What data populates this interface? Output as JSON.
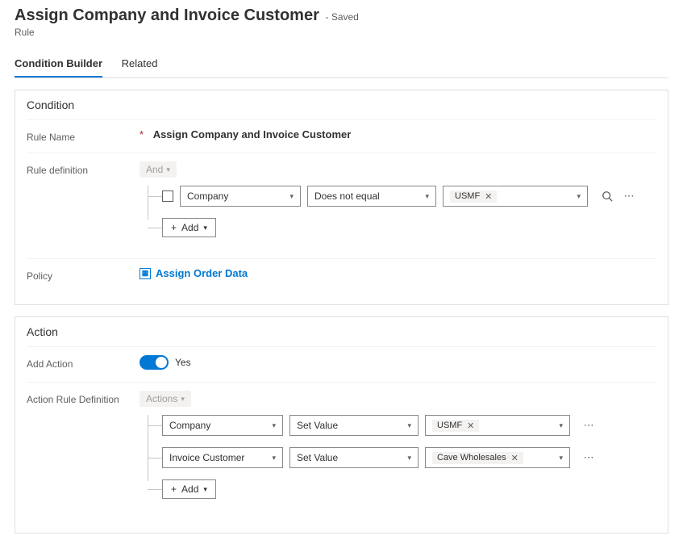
{
  "header": {
    "title": "Assign Company and Invoice Customer",
    "status_suffix": "- Saved",
    "subtitle": "Rule"
  },
  "tabs": {
    "items": [
      "Condition Builder",
      "Related"
    ],
    "active_index": 0
  },
  "condition_panel": {
    "title": "Condition",
    "rule_name_label": "Rule Name",
    "rule_name_value": "Assign Company and Invoice Customer",
    "rule_def_label": "Rule definition",
    "root_operator": "And",
    "rows": [
      {
        "field": "Company",
        "operator": "Does not equal",
        "value": "USMF"
      }
    ],
    "add_label": "Add",
    "policy_label": "Policy",
    "policy_link": "Assign Order Data"
  },
  "action_panel": {
    "title": "Action",
    "add_action_label": "Add Action",
    "add_action_value": "Yes",
    "def_label": "Action Rule Definition",
    "root_operator": "Actions",
    "rows": [
      {
        "field": "Company",
        "operator": "Set Value",
        "value": "USMF"
      },
      {
        "field": "Invoice Customer",
        "operator": "Set Value",
        "value": "Cave Wholesales"
      }
    ],
    "add_label": "Add"
  }
}
